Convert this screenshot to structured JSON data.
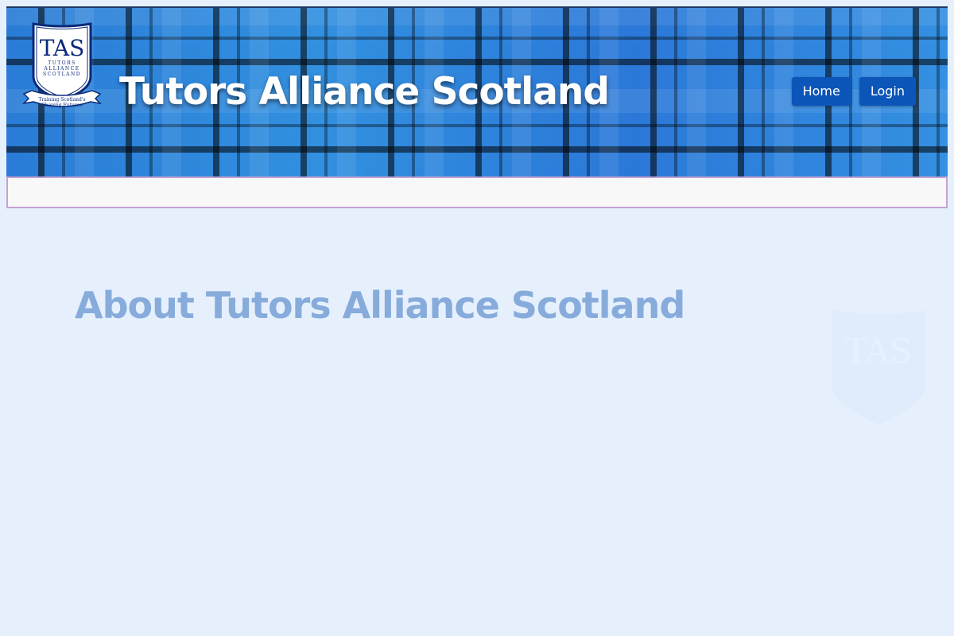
{
  "header": {
    "site_title": "Tutors Alliance Scotland",
    "logo": {
      "monogram": "TAS",
      "line1": "TUTORS",
      "line2": "ALLIANCE",
      "line3": "SCOTLAND",
      "ribbon1": "Training Scotland's",
      "ribbon2": "Shaping Futures"
    },
    "nav": {
      "home_label": "Home",
      "login_label": "Login"
    }
  },
  "main": {
    "heading": "About Tutors Alliance Scotland"
  },
  "watermark": {
    "monogram": "TAS"
  },
  "colors": {
    "page_background": "#e6f0fd",
    "header_tartan_blue": "#2b80d8",
    "nav_button": "#0d56b9",
    "heading_text": "#87acdb",
    "subnav_border": "#c6a1d2",
    "subnav_background": "#f8f8f8"
  },
  "icons": {
    "logo": "shield-crest-icon",
    "watermark": "shield-watermark-icon"
  }
}
